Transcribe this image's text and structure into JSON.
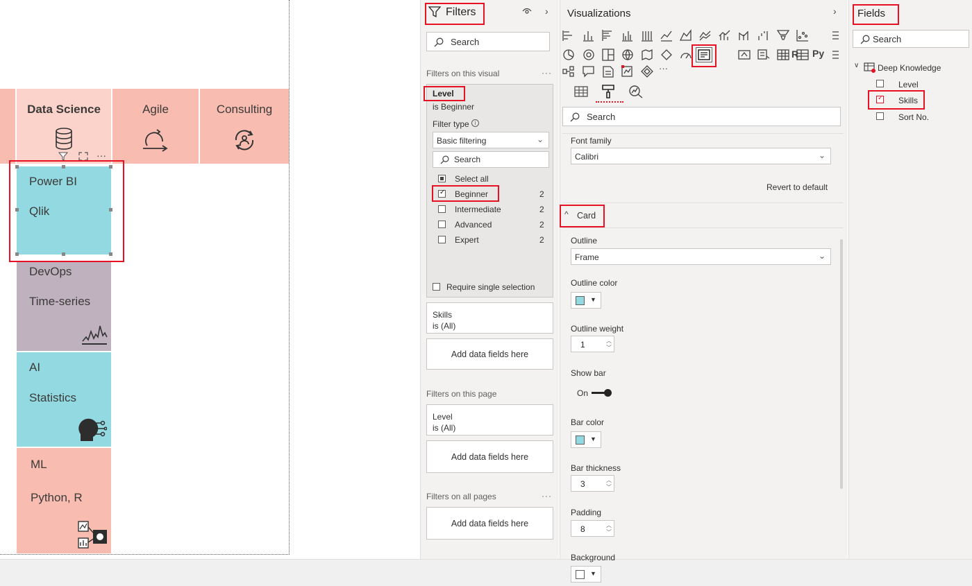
{
  "canvas": {
    "header_tiles": [
      {
        "label": "Data Science",
        "bold": true
      },
      {
        "label": "Agile",
        "bold": false
      },
      {
        "label": "Consulting",
        "bold": false
      }
    ],
    "cards": [
      {
        "lines": [
          "Power BI",
          "Qlik"
        ],
        "color": "#93d9e2"
      },
      {
        "lines": [
          "DevOps",
          "Time-series"
        ],
        "color": "#bfb1bd"
      },
      {
        "lines": [
          "AI",
          "Statistics"
        ],
        "color": "#93d9e2"
      },
      {
        "lines": [
          "ML",
          "Python, R"
        ],
        "color": "#f8bcb0"
      }
    ],
    "visual_header_more": "···"
  },
  "filters": {
    "title": "Filters",
    "search_placeholder": "Search",
    "on_this_visual": "Filters on this visual",
    "more": "···",
    "level_card": {
      "field": "Level",
      "summary": "is Beginner",
      "filter_type_label": "Filter type",
      "filter_type_value": "Basic filtering",
      "search_placeholder": "Search",
      "select_all": "Select all",
      "options": [
        {
          "label": "Beginner",
          "count": "2",
          "checked": true
        },
        {
          "label": "Intermediate",
          "count": "2",
          "checked": false
        },
        {
          "label": "Advanced",
          "count": "2",
          "checked": false
        },
        {
          "label": "Expert",
          "count": "2",
          "checked": false
        }
      ],
      "require_single": "Require single selection"
    },
    "skills_card": {
      "field": "Skills",
      "summary": "is (All)"
    },
    "add_fields": "Add data fields here",
    "on_this_page": "Filters on this page",
    "page_level_card": {
      "field": "Level",
      "summary": "is (All)"
    },
    "on_all_pages": "Filters on all pages"
  },
  "visualizations": {
    "title": "Visualizations",
    "icon_r": "R",
    "icon_py": "Py",
    "more": "···",
    "search_placeholder": "Search",
    "font_family_label": "Font family",
    "font_family_value": "Calibri",
    "revert": "Revert to default",
    "card_section": "Card",
    "outline_label": "Outline",
    "outline_value": "Frame",
    "outline_color_label": "Outline color",
    "outline_color": "#93d9e2",
    "outline_weight_label": "Outline weight",
    "outline_weight_value": "1",
    "show_bar_label": "Show bar",
    "show_bar_value": "On",
    "bar_color_label": "Bar color",
    "bar_color": "#93d9e2",
    "bar_thickness_label": "Bar thickness",
    "bar_thickness_value": "3",
    "padding_label": "Padding",
    "padding_value": "8",
    "background_label": "Background",
    "background_color": "#ffffff"
  },
  "fields": {
    "title": "Fields",
    "search_placeholder": "Search",
    "table": "Deep Knowledge",
    "items": [
      {
        "label": "Level",
        "checked": false
      },
      {
        "label": "Skills",
        "checked": true
      },
      {
        "label": "Sort No.",
        "checked": false
      }
    ]
  },
  "colors": {
    "highlight": "#e81123",
    "salmon": "#f8bcb0",
    "teal": "#93d9e2",
    "mauve": "#bfb1bd"
  }
}
